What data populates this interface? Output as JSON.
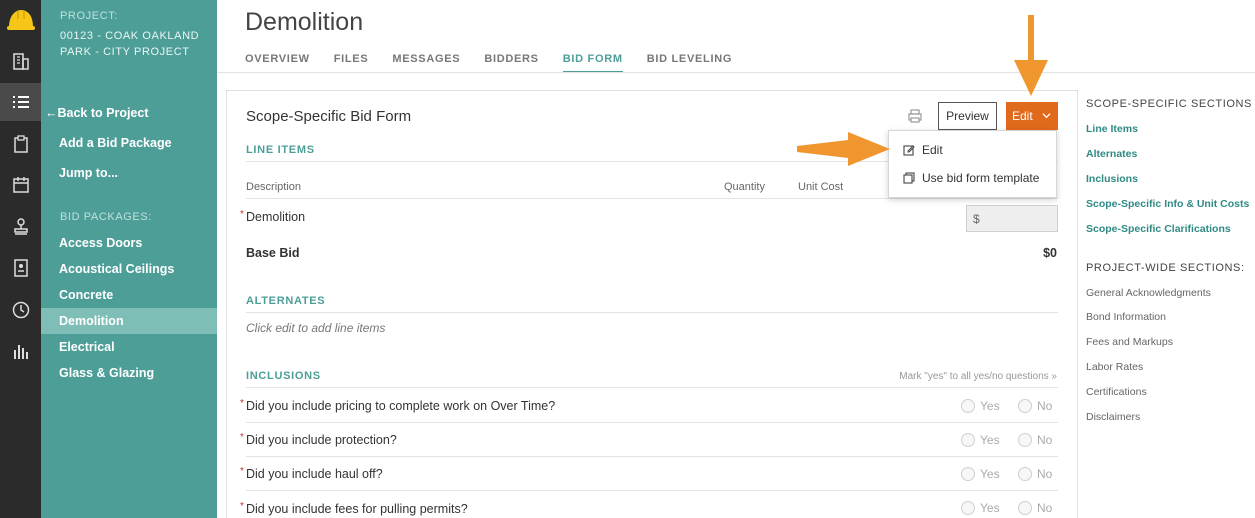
{
  "sidebar": {
    "project_label": "PROJECT:",
    "project_name": "00123 - COAK OAKLAND PARK - CITY PROJECT",
    "back_link": "Back to Project",
    "add_bid_package": "Add a Bid Package",
    "jump_to": "Jump to...",
    "bid_packages_label": "BID PACKAGES:",
    "packages": [
      "Access Doors",
      "Acoustical Ceilings",
      "Concrete",
      "Demolition",
      "Electrical",
      "Glass & Glazing"
    ],
    "active_package": "Demolition"
  },
  "header": {
    "title": "Demolition",
    "tabs": [
      "OVERVIEW",
      "FILES",
      "MESSAGES",
      "BIDDERS",
      "BID FORM",
      "BID LEVELING"
    ],
    "active_tab": "BID FORM"
  },
  "form": {
    "title": "Scope-Specific Bid Form",
    "preview_label": "Preview",
    "edit_label": "Edit",
    "line_items_heading": "LINE ITEMS",
    "columns": {
      "description": "Description",
      "quantity": "Quantity",
      "unit_cost": "Unit Cost"
    },
    "line_item": "Demolition",
    "currency_placeholder": "$",
    "base_bid_label": "Base Bid",
    "base_bid_value": "$0",
    "alternates_heading": "ALTERNATES",
    "alternates_hint": "Click edit to add line items",
    "inclusions_heading": "INCLUSIONS",
    "mark_yes_link": "Mark \"yes\" to all yes/no questions »",
    "yes_label": "Yes",
    "no_label": "No",
    "questions": [
      "Did you include pricing to complete work on Over Time?",
      "Did you include protection?",
      "Did you include haul off?",
      "Did you include fees for pulling permits?"
    ]
  },
  "dropdown": {
    "items": [
      "Edit",
      "Use bid form template"
    ]
  },
  "toc": {
    "scope_heading": "SCOPE-SPECIFIC SECTIONS",
    "scope_items": [
      "Line Items",
      "Alternates",
      "Inclusions",
      "Scope-Specific Info & Unit Costs",
      "Scope-Specific Clarifications"
    ],
    "project_heading": "PROJECT-WIDE SECTIONS:",
    "project_items": [
      "General Acknowledgments",
      "Bond Information",
      "Fees and Markups",
      "Labor Rates",
      "Certifications",
      "Disclaimers"
    ]
  },
  "colors": {
    "teal": "#4e9e98",
    "teal_active": "#7fbdb7",
    "orange": "#e06a1c",
    "arrow": "#f0962e",
    "rail": "#2b2b2b"
  },
  "icons": [
    "logo-hardhat-icon",
    "building-icon",
    "list-icon",
    "clipboard-icon",
    "calendar-icon",
    "stamp-icon",
    "address-book-icon",
    "clock-icon",
    "bar-chart-icon",
    "print-icon",
    "edit-pencil-icon",
    "copy-template-icon",
    "chevron-down-icon",
    "back-arrow-icon"
  ]
}
